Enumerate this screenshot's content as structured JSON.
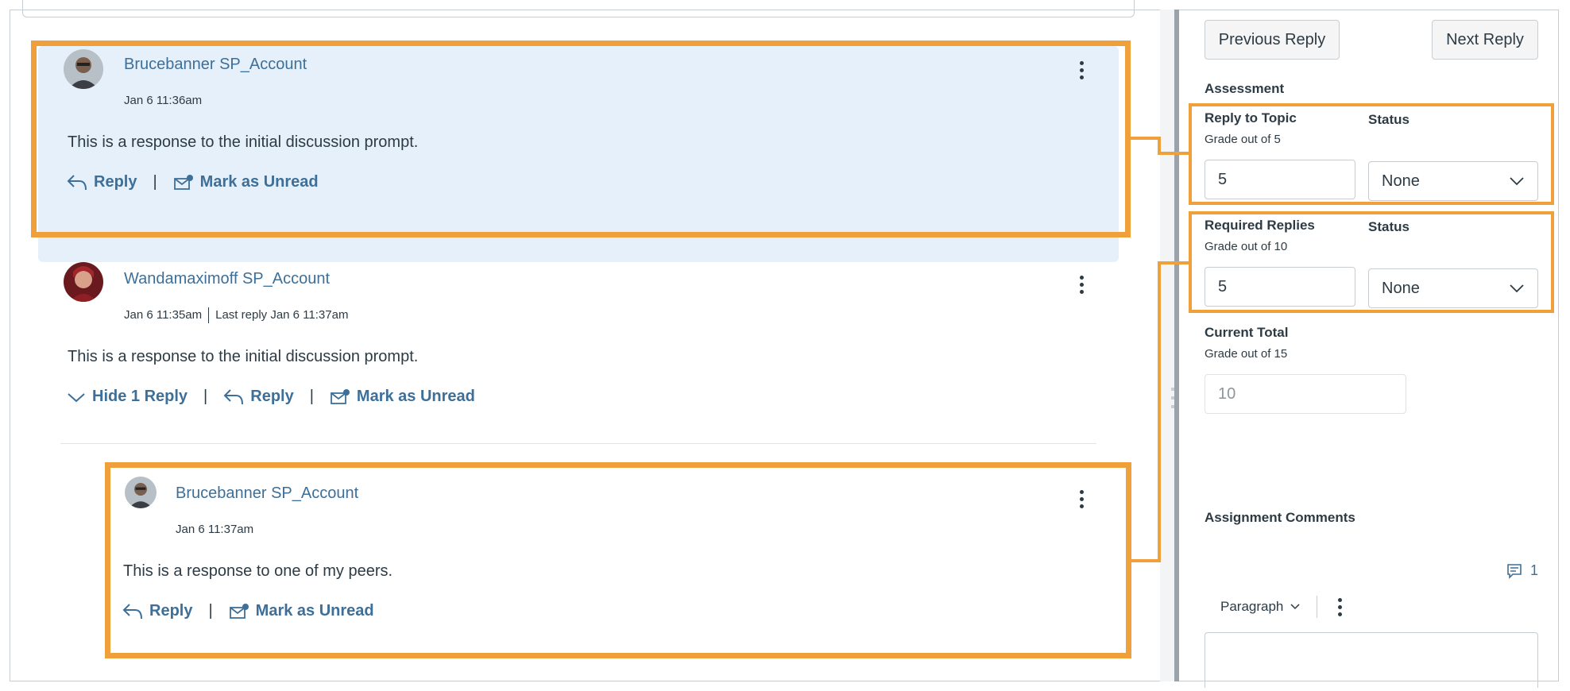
{
  "colors": {
    "accent": "#f0a03a",
    "link": "#3d6f98",
    "text": "#2d3b45",
    "highlight": "#e6f0fa"
  },
  "posts": [
    {
      "author": "Brucebanner SP_Account",
      "date": "Jan 6 11:36am",
      "body": "This is a response to the initial discussion prompt.",
      "reply_label": "Reply",
      "unread_label": "Mark as Unread"
    },
    {
      "author": "Wandamaximoff SP_Account",
      "date": "Jan 6 11:35am",
      "last_reply": "Last reply Jan 6 11:37am",
      "body": "This is a response to the initial discussion prompt.",
      "hide_label": "Hide 1 Reply",
      "reply_label": "Reply",
      "unread_label": "Mark as Unread"
    },
    {
      "author": "Brucebanner SP_Account",
      "date": "Jan 6 11:37am",
      "body": "This is a response to one of my peers.",
      "reply_label": "Reply",
      "unread_label": "Mark as Unread"
    }
  ],
  "sidebar": {
    "prev_button": "Previous Reply",
    "next_button": "Next Reply",
    "assessment_label": "Assessment",
    "reply_to_topic": {
      "label": "Reply to Topic",
      "sub": "Grade out of 5",
      "value": "5",
      "status_label": "Status",
      "status_value": "None"
    },
    "required_replies": {
      "label": "Required Replies",
      "sub": "Grade out of 10",
      "value": "5",
      "status_label": "Status",
      "status_value": "None"
    },
    "current_total": {
      "label": "Current Total",
      "sub": "Grade out of 15",
      "value": "10"
    },
    "assignment_comments": "Assignment Comments",
    "comment_count": "1",
    "editor_format": "Paragraph"
  }
}
